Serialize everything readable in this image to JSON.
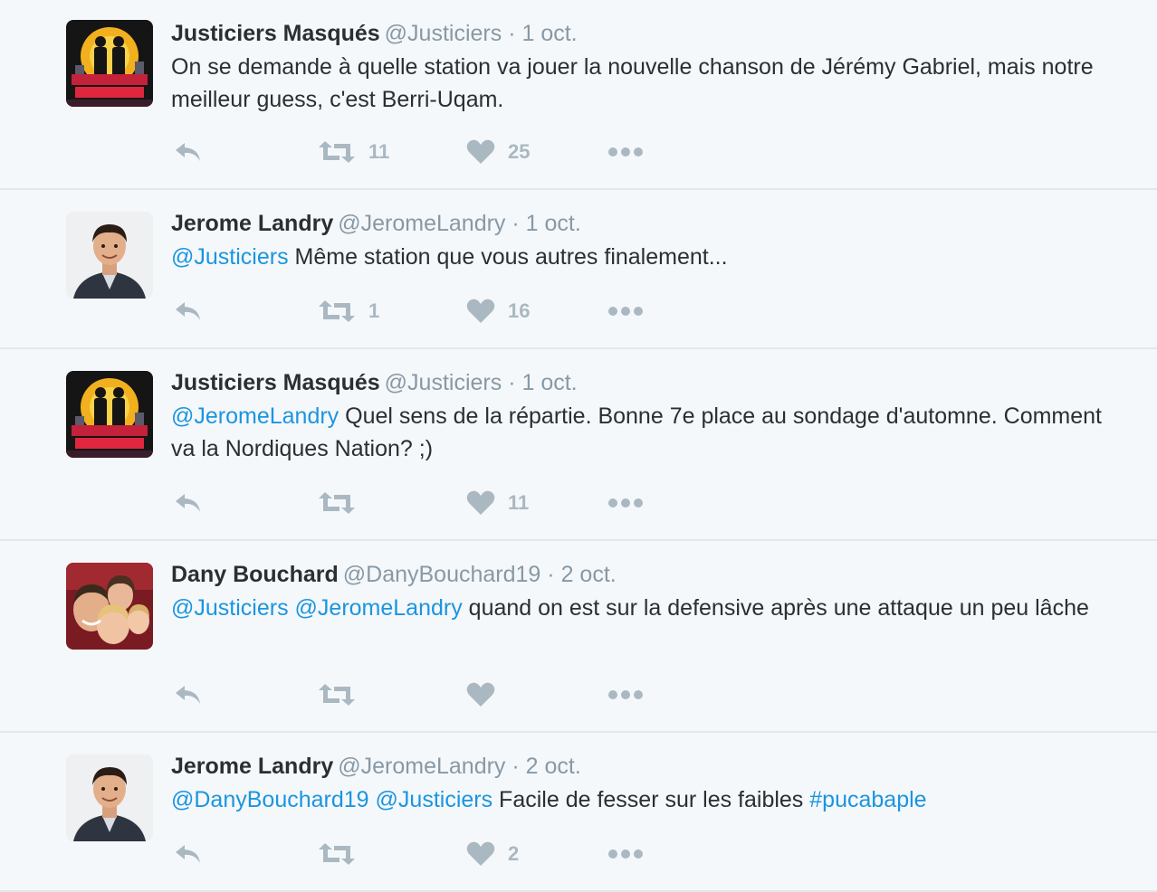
{
  "icons": {
    "reply": "reply-icon",
    "retweet": "retweet-icon",
    "like": "heart-icon",
    "more": "more-icon"
  },
  "colors": {
    "mention": "#1b95e0",
    "action_grey": "#aab8c2",
    "background": "#f5f8fa"
  },
  "tweets": [
    {
      "name": "Justiciers Masqués",
      "handle": "@Justiciers",
      "separator": "·",
      "date": "1 oct.",
      "text_plain": "On se demande à quelle station va jouer la nouvelle chanson de Jérémy Gabriel, mais notre meilleur guess, c'est Berri-Uqam.",
      "retweets": "11",
      "likes": "25"
    },
    {
      "name": "Jerome Landry",
      "handle": "@JeromeLandry",
      "separator": "·",
      "date": "1 oct.",
      "mention_1": "@Justiciers",
      "text_rest": " Même station que vous autres finalement...",
      "retweets": "1",
      "likes": "16"
    },
    {
      "name": "Justiciers Masqués",
      "handle": "@Justiciers",
      "separator": "·",
      "date": "1 oct.",
      "mention_1": "@JeromeLandry",
      "text_rest": " Quel sens de la répartie. Bonne 7e place au sondage d'automne. Comment va la Nordiques Nation? ;)",
      "retweets": "",
      "likes": "11"
    },
    {
      "name": "Dany Bouchard",
      "handle": "@DanyBouchard19",
      "separator": "·",
      "date": "2 oct.",
      "mention_1": "@Justiciers",
      "mention_2": "@JeromeLandry",
      "text_rest": " quand on est sur la defensive après une attaque un peu lâche",
      "retweets": "",
      "likes": ""
    },
    {
      "name": "Jerome Landry",
      "handle": "@JeromeLandry",
      "separator": "·",
      "date": "2 oct.",
      "mention_1": "@DanyBouchard19",
      "mention_2": "@Justiciers",
      "text_rest": " Facile de fesser sur les faibles ",
      "hashtag": "#pucabaple",
      "retweets": "",
      "likes": "2"
    }
  ]
}
